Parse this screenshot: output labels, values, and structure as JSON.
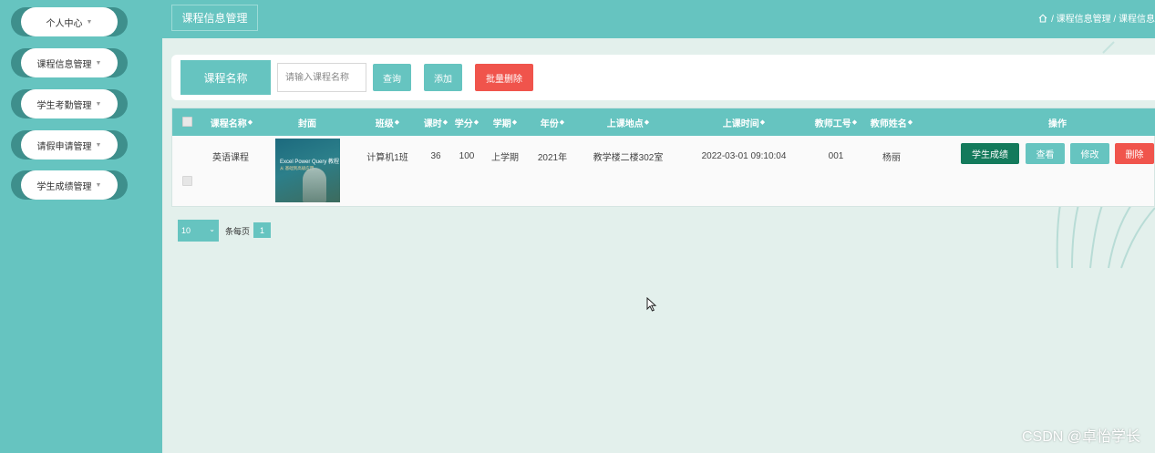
{
  "sidebar": {
    "items": [
      {
        "label": "个人中心"
      },
      {
        "label": "课程信息管理"
      },
      {
        "label": "学生考勤管理"
      },
      {
        "label": "请假申请管理"
      },
      {
        "label": "学生成绩管理"
      }
    ]
  },
  "header": {
    "tab_label": "课程信息管理",
    "breadcrumb": "/ 课程信息管理 / 课程信息"
  },
  "search": {
    "label": "课程名称",
    "placeholder": "请输入课程名称",
    "value": "",
    "query_label": "查询",
    "add_label": "添加",
    "batch_delete_label": "批量删除"
  },
  "table": {
    "columns": [
      "课程名称",
      "封面",
      "班级",
      "课时",
      "学分",
      "学期",
      "年份",
      "上课地点",
      "上课时间",
      "教师工号",
      "教师姓名",
      "操作"
    ],
    "rows": [
      {
        "course_name": "英语课程",
        "cover_title": "Excel Power Query 教程",
        "cover_subtitle": "从 基础到高级应用",
        "class": "计算机1班",
        "hours": "36",
        "credits": "100",
        "semester": "上学期",
        "year": "2021年",
        "location": "教学楼二楼302室",
        "time": "2022-03-01 09:10:04",
        "teacher_id": "001",
        "teacher_name": "杨丽"
      }
    ],
    "actions": {
      "score": "学生成绩",
      "view": "查看",
      "edit": "修改",
      "delete": "删除"
    }
  },
  "pagination": {
    "page_size": "10",
    "per_page_label": "条每页",
    "current_page": "1"
  },
  "watermark": "CSDN @卓怡学长",
  "colors": {
    "primary": "#66c4c0",
    "danger": "#f0544c",
    "success_dark": "#137a5b",
    "background": "#e3f0ec"
  }
}
